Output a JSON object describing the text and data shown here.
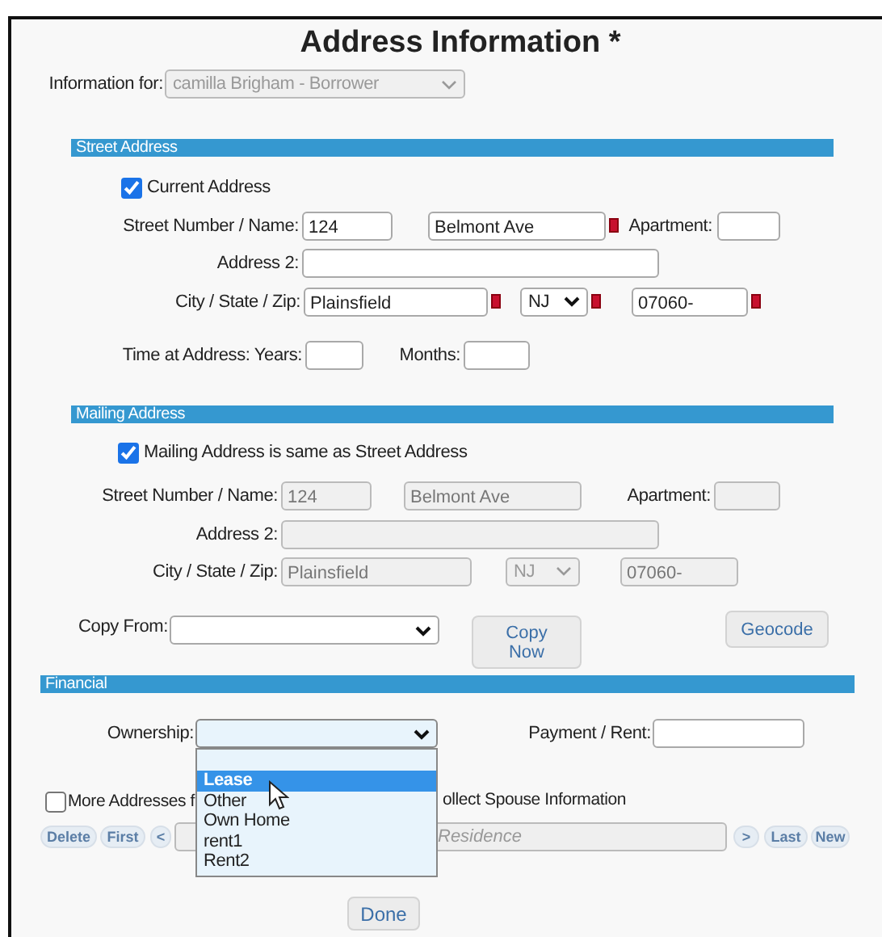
{
  "title": "Address Information *",
  "information_for": {
    "label": "Information for:",
    "value": "camilla Brigham - Borrower",
    "disabled": true
  },
  "street_address": {
    "title": "Street Address",
    "checkbox": {
      "label": "Current Address",
      "checked": true
    },
    "rows": [
      {
        "label": "Street Number / Name:",
        "controls": [
          {
            "kind": "input",
            "value": "124"
          },
          {
            "kind": "input",
            "value": "Belmont Ave",
            "required": true
          },
          {
            "kind": "label",
            "text": "Apartment:"
          },
          {
            "kind": "input"
          }
        ]
      },
      {
        "label": "Address 2:",
        "controls": [
          {
            "kind": "input"
          }
        ]
      },
      {
        "label": "City / State / Zip:",
        "controls": [
          {
            "kind": "input",
            "value": "Plainsfield",
            "required": true
          },
          {
            "kind": "select",
            "value": "NJ",
            "required": true
          },
          {
            "kind": "input",
            "value": "07060-",
            "required": true
          }
        ]
      },
      {
        "label": "Time at Address: Years:",
        "controls": [
          {
            "kind": "input"
          },
          {
            "kind": "label",
            "text": "Months:"
          },
          {
            "kind": "input"
          }
        ]
      }
    ]
  },
  "mailing_address": {
    "title": "Mailing Address",
    "checkbox": {
      "label": "Mailing Address is same as Street Address",
      "checked": true
    },
    "disabled": true,
    "rows": [
      {
        "label": "Street Number / Name:",
        "controls": [
          {
            "kind": "input",
            "value": "124"
          },
          {
            "kind": "input",
            "value": "Belmont Ave"
          },
          {
            "kind": "label",
            "text": "Apartment:"
          },
          {
            "kind": "input"
          }
        ]
      },
      {
        "label": "Address 2:",
        "controls": [
          {
            "kind": "input"
          }
        ]
      },
      {
        "label": "City / State / Zip:",
        "controls": [
          {
            "kind": "input",
            "value": "Plainsfield"
          },
          {
            "kind": "select",
            "value": "NJ"
          },
          {
            "kind": "input",
            "value": "07060-"
          }
        ]
      }
    ],
    "copy_from": {
      "label": "Copy From:"
    },
    "copy_now_button": "Copy Now",
    "geocode_button": "Geocode"
  },
  "financial": {
    "title": "Financial",
    "ownership": {
      "label": "Ownership:",
      "expanded": true,
      "options": [
        {
          "label": "Lease",
          "selected": true
        },
        {
          "label": "Other",
          "selected": false
        },
        {
          "label": "Own Home",
          "selected": false
        },
        {
          "label": "rent1",
          "selected": false
        },
        {
          "label": "Rent2",
          "selected": false
        }
      ]
    },
    "payment": {
      "label": "Payment / Rent:"
    }
  },
  "more_addresses": {
    "label": "More Addresses f",
    "checked": false
  },
  "spouse_text": "ollect Spouse Information",
  "navigation": {
    "buttons_left": [
      "Delete",
      "First",
      "<"
    ],
    "field": {
      "placeholder": "Residence"
    },
    "buttons_right": [
      ">",
      "Last",
      "New"
    ]
  },
  "done_button": "Done"
}
